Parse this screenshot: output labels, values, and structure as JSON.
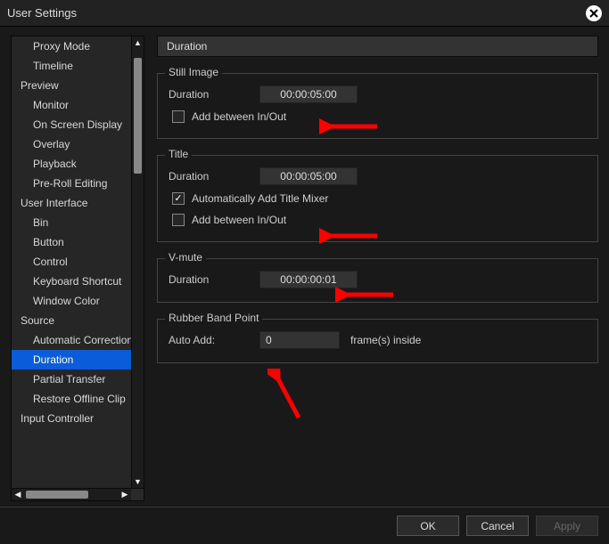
{
  "window": {
    "title": "User Settings"
  },
  "sidebar": {
    "items": [
      {
        "label": "Proxy Mode",
        "kind": "leaf"
      },
      {
        "label": "Timeline",
        "kind": "leaf"
      },
      {
        "label": "Preview",
        "kind": "group"
      },
      {
        "label": "Monitor",
        "kind": "leaf"
      },
      {
        "label": "On Screen Display",
        "kind": "leaf"
      },
      {
        "label": "Overlay",
        "kind": "leaf"
      },
      {
        "label": "Playback",
        "kind": "leaf"
      },
      {
        "label": "Pre-Roll Editing",
        "kind": "leaf"
      },
      {
        "label": "User Interface",
        "kind": "group"
      },
      {
        "label": "Bin",
        "kind": "leaf"
      },
      {
        "label": "Button",
        "kind": "leaf"
      },
      {
        "label": "Control",
        "kind": "leaf"
      },
      {
        "label": "Keyboard Shortcut",
        "kind": "leaf"
      },
      {
        "label": "Window Color",
        "kind": "leaf"
      },
      {
        "label": "Source",
        "kind": "group"
      },
      {
        "label": "Automatic Correction",
        "kind": "leaf"
      },
      {
        "label": "Duration",
        "kind": "leaf",
        "selected": true
      },
      {
        "label": "Partial Transfer",
        "kind": "leaf"
      },
      {
        "label": "Restore Offline Clip",
        "kind": "leaf"
      },
      {
        "label": "Input Controller",
        "kind": "group"
      }
    ]
  },
  "pane": {
    "title": "Duration",
    "still": {
      "legend": "Still Image",
      "duration_label": "Duration",
      "duration_value": "00:00:05:00",
      "add_between_label": "Add between In/Out",
      "add_between_checked": false
    },
    "title_group": {
      "legend": "Title",
      "duration_label": "Duration",
      "duration_value": "00:00:05:00",
      "auto_mixer_label": "Automatically Add Title Mixer",
      "auto_mixer_checked": true,
      "add_between_label": "Add between In/Out",
      "add_between_checked": false
    },
    "vmute": {
      "legend": "V-mute",
      "duration_label": "Duration",
      "duration_value": "00:00:00:01"
    },
    "rubber": {
      "legend": "Rubber Band Point",
      "auto_add_label": "Auto Add:",
      "auto_add_value": "0",
      "suffix": "frame(s) inside"
    }
  },
  "footer": {
    "ok": "OK",
    "cancel": "Cancel",
    "apply": "Apply"
  },
  "annotation_color": "#ff0000"
}
